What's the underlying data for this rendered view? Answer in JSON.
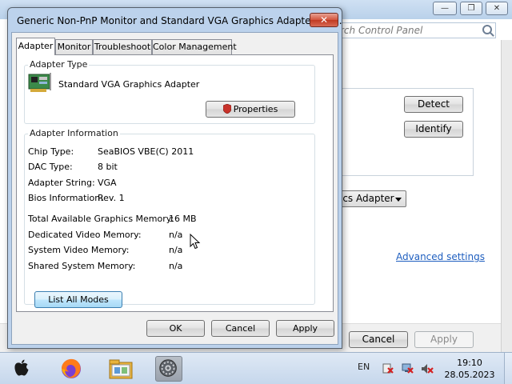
{
  "background_window": {
    "title_controls": [
      "—",
      "❐",
      "✕"
    ],
    "search_placeholder": "rch Control Panel",
    "detect_label": "Detect",
    "identify_label": "Identify",
    "display_select_value": "ics Adapter",
    "advanced_link": "Advanced settings",
    "cancel_label": "Cancel",
    "apply_label": "Apply"
  },
  "dialog": {
    "title": "Generic Non-PnP Monitor and Standard VGA Graphics Adapter Pro...",
    "close_label": "✕",
    "tabs": [
      {
        "label": "Adapter",
        "active": true
      },
      {
        "label": "Monitor",
        "active": false
      },
      {
        "label": "Troubleshoot",
        "active": false
      },
      {
        "label": "Color Management",
        "active": false
      }
    ],
    "adapter_type": {
      "legend": "Adapter Type",
      "name": "Standard VGA Graphics Adapter",
      "properties_label": "Properties"
    },
    "adapter_info": {
      "legend": "Adapter Information",
      "rows": [
        {
          "label": "Chip Type:",
          "value": "SeaBIOS VBE(C) 2011"
        },
        {
          "label": "DAC Type:",
          "value": "8 bit"
        },
        {
          "label": "Adapter String:",
          "value": "VGA"
        },
        {
          "label": "Bios Information:",
          "value": "Rev. 1"
        }
      ],
      "memory_rows": [
        {
          "label": "Total Available Graphics Memory:",
          "value": "16 MB"
        },
        {
          "label": "Dedicated Video Memory:",
          "value": "n/a"
        },
        {
          "label": "System Video Memory:",
          "value": "n/a"
        },
        {
          "label": "Shared System Memory:",
          "value": "n/a"
        }
      ]
    },
    "list_all_modes_label": "List All Modes",
    "buttons": {
      "ok": "OK",
      "cancel": "Cancel",
      "apply": "Apply"
    }
  },
  "taskbar": {
    "apps": [
      {
        "name": "apple-icon"
      },
      {
        "name": "firefox-icon"
      },
      {
        "name": "file-explorer-icon"
      },
      {
        "name": "settings-icon",
        "active": true
      }
    ],
    "language": "EN",
    "time": "19:10",
    "date": "28.05.2023"
  },
  "colors": {
    "title_bar": "#bcd2ec",
    "close_button": "#c84a33",
    "link": "#1e5ebf",
    "taskbar": "#c6d7ec"
  }
}
